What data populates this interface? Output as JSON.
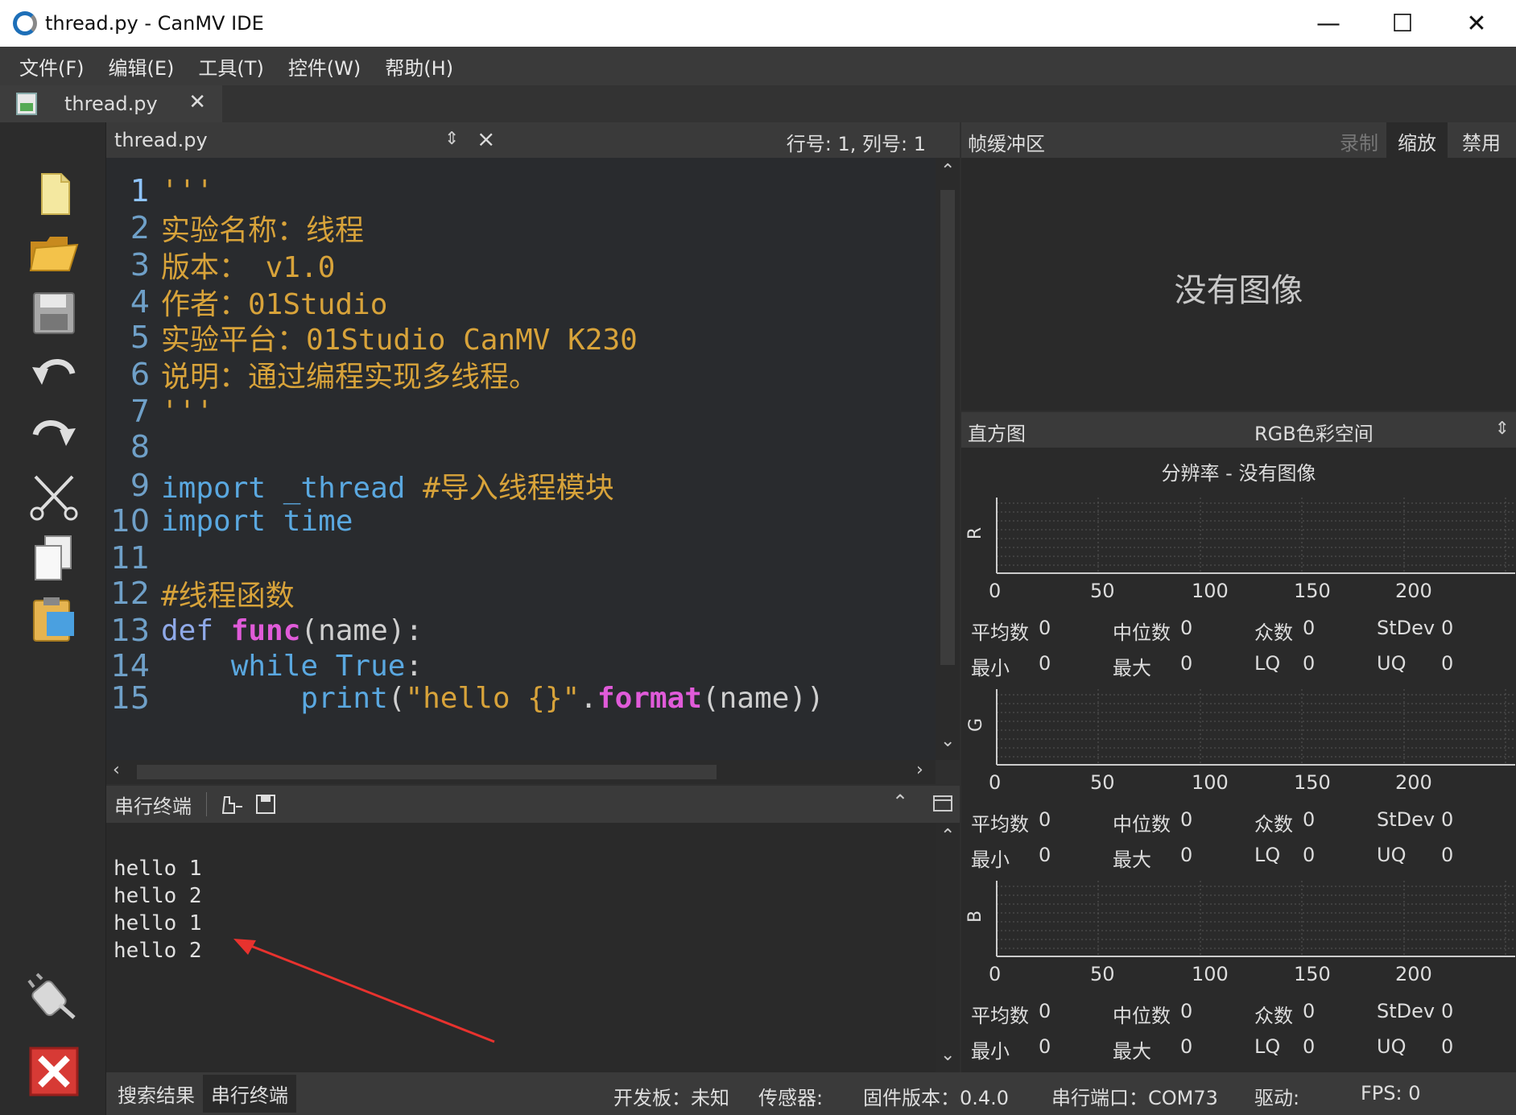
{
  "window": {
    "title": "thread.py - CanMV IDE",
    "minimize": "—",
    "maximize": "☐",
    "close": "✕"
  },
  "menu": [
    "文件(F)",
    "编辑(E)",
    "工具(T)",
    "控件(W)",
    "帮助(H)"
  ],
  "doc_tab": {
    "name": "thread.py",
    "close": "✕"
  },
  "editor": {
    "file": "thread.py",
    "position": "行号: 1, 列号: 1",
    "lines": [
      {
        "n": "1",
        "segs": [
          [
            "str",
            "'''"
          ]
        ]
      },
      {
        "n": "2",
        "segs": [
          [
            "str",
            "实验名称：线程"
          ]
        ]
      },
      {
        "n": "3",
        "segs": [
          [
            "str",
            "版本： v1.0"
          ]
        ]
      },
      {
        "n": "4",
        "segs": [
          [
            "str",
            "作者：01Studio"
          ]
        ]
      },
      {
        "n": "5",
        "segs": [
          [
            "str",
            "实验平台：01Studio CanMV K230"
          ]
        ]
      },
      {
        "n": "6",
        "segs": [
          [
            "str",
            "说明：通过编程实现多线程。"
          ]
        ]
      },
      {
        "n": "7",
        "segs": [
          [
            "str",
            "'''"
          ]
        ]
      },
      {
        "n": "8",
        "segs": []
      },
      {
        "n": "9",
        "segs": [
          [
            "kw",
            "import "
          ],
          [
            "mod",
            "_thread "
          ],
          [
            "com",
            "#导入线程模块"
          ]
        ]
      },
      {
        "n": "10",
        "segs": [
          [
            "kw",
            "import "
          ],
          [
            "mod",
            "time"
          ]
        ]
      },
      {
        "n": "11",
        "segs": []
      },
      {
        "n": "12",
        "segs": [
          [
            "com",
            "#线程函数"
          ]
        ]
      },
      {
        "n": "13",
        "segs": [
          [
            "def",
            "def "
          ],
          [
            "fn",
            "func"
          ],
          [
            "txt",
            "(name):"
          ]
        ]
      },
      {
        "n": "14",
        "segs": [
          [
            "txt",
            "    "
          ],
          [
            "kw",
            "while True"
          ],
          [
            "txt",
            ":"
          ]
        ]
      },
      {
        "n": "15",
        "segs": [
          [
            "txt",
            "        "
          ],
          [
            "kw",
            "print"
          ],
          [
            "txt",
            "("
          ],
          [
            "str",
            "\"hello {}\""
          ],
          [
            "txt",
            "."
          ],
          [
            "fn",
            "format"
          ],
          [
            "txt",
            "(name))"
          ]
        ]
      }
    ]
  },
  "terminal": {
    "label": "串行终端",
    "output": [
      "hello 1",
      "hello 2",
      "hello 1",
      "hello 2"
    ]
  },
  "status": {
    "tabs": [
      "搜索结果",
      "串行终端"
    ],
    "board": "开发板：未知",
    "sensor": "传感器:",
    "firmware": "固件版本：0.4.0",
    "port": "串行端口：COM73",
    "driver": "驱动:",
    "fps": "FPS: 0"
  },
  "framebuffer": {
    "label": "帧缓冲区",
    "buttons": [
      "录制",
      "缩放",
      "禁用"
    ],
    "no_image": "没有图像"
  },
  "histogram": {
    "label": "直方图",
    "colorspace": "RGB色彩空间",
    "resolution": "分辨率 - 没有图像",
    "ticks": [
      "0",
      "50",
      "100",
      "150",
      "200"
    ],
    "channels": [
      {
        "name": "R",
        "mean": "平均数",
        "mean_v": "0",
        "median": "中位数",
        "median_v": "0",
        "mode": "众数",
        "mode_v": "0",
        "stdev": "StDev",
        "stdev_v": "0",
        "min": "最小",
        "min_v": "0",
        "max": "最大",
        "max_v": "0",
        "lq": "LQ",
        "lq_v": "0",
        "uq": "UQ",
        "uq_v": "0"
      },
      {
        "name": "G",
        "mean": "平均数",
        "mean_v": "0",
        "median": "中位数",
        "median_v": "0",
        "mode": "众数",
        "mode_v": "0",
        "stdev": "StDev",
        "stdev_v": "0",
        "min": "最小",
        "min_v": "0",
        "max": "最大",
        "max_v": "0",
        "lq": "LQ",
        "lq_v": "0",
        "uq": "UQ",
        "uq_v": "0"
      },
      {
        "name": "B",
        "mean": "平均数",
        "mean_v": "0",
        "median": "中位数",
        "median_v": "0",
        "mode": "众数",
        "mode_v": "0",
        "stdev": "StDev",
        "stdev_v": "0",
        "min": "最小",
        "min_v": "0",
        "max": "最大",
        "max_v": "0",
        "lq": "LQ",
        "lq_v": "0",
        "uq": "UQ",
        "uq_v": "0"
      }
    ]
  },
  "colors": {
    "accent_red": "#e8322e",
    "string": "#d8a33a",
    "keyword": "#5aa8e0",
    "function": "#e05bd9"
  }
}
